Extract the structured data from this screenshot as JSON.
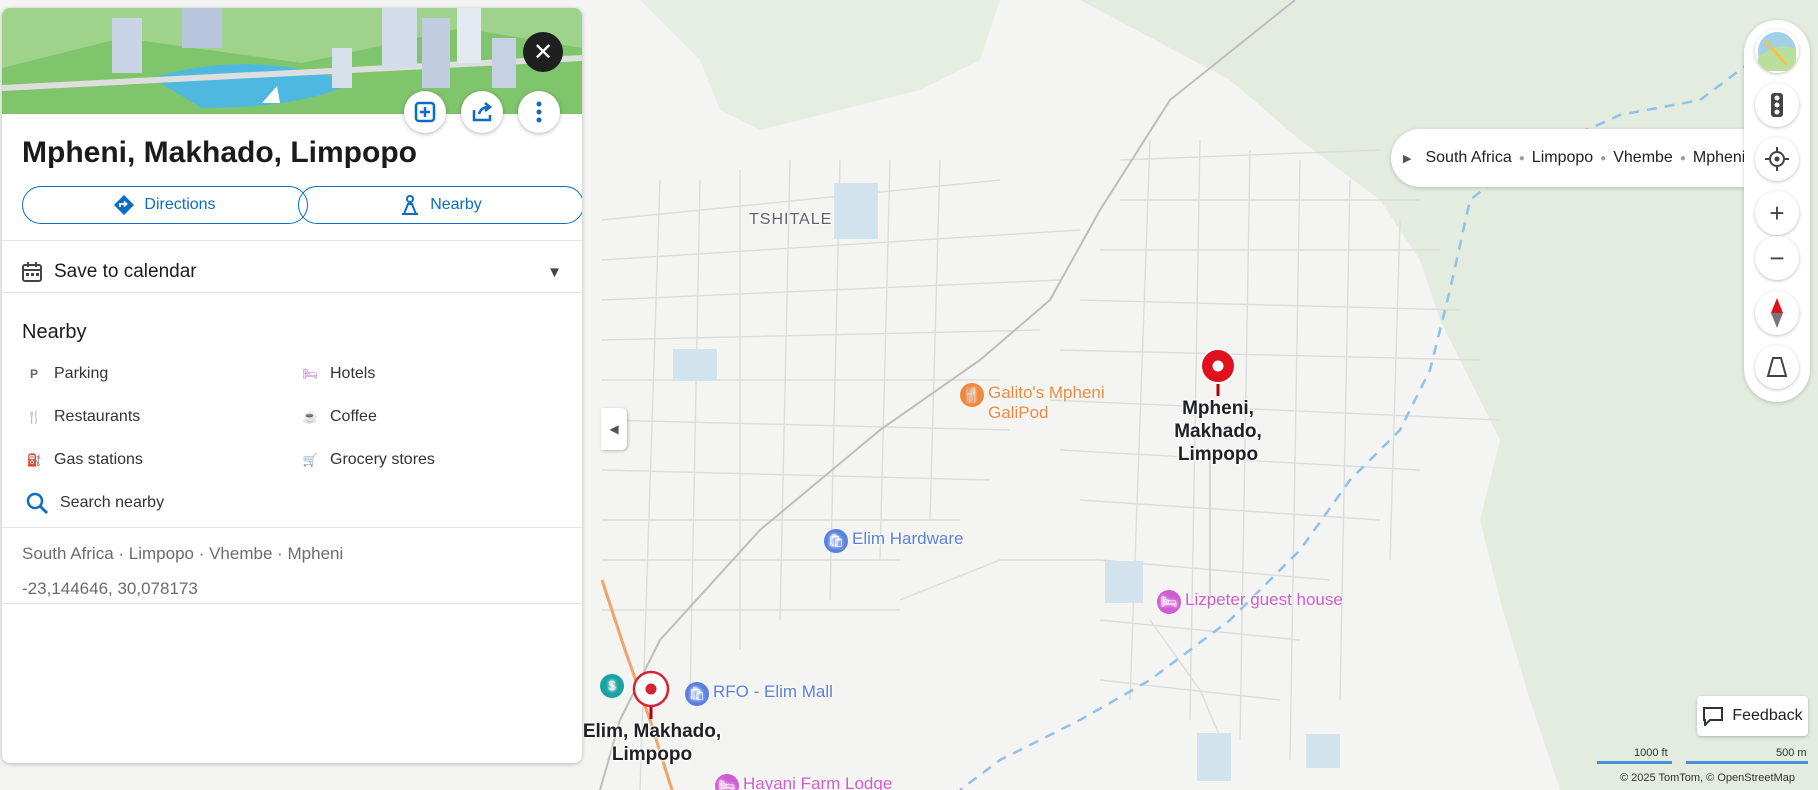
{
  "panel": {
    "title": "Mpheni, Makhado, Limpopo",
    "directions_label": "Directions",
    "nearby_label": "Nearby",
    "calendar_label": "Save to calendar",
    "nearby_heading": "Nearby",
    "nearby_items": [
      "Parking",
      "Hotels",
      "Restaurants",
      "Coffee",
      "Gas stations",
      "Grocery stores"
    ],
    "search_nearby_label": "Search nearby",
    "address": "South Africa · Limpopo · Vhembe · Mpheni",
    "coordinates": "-23,144646, 30,078173",
    "icons": [
      "close-icon",
      "save-icon",
      "share-icon",
      "more-icon",
      "directions-icon",
      "nearby-icon",
      "calendar-icon",
      "chevron-down-icon",
      "search-icon"
    ]
  },
  "breadcrumbs": [
    "South Africa",
    "Limpopo",
    "Vhembe",
    "Mpheni"
  ],
  "map": {
    "area_label": "TSHITALE",
    "pin_main_label": "Mpheni, Makhado, Limpopo",
    "pin_secondary_label": "Elim, Makhado, Limpopo",
    "pois": [
      {
        "name": "Galito's Mpheni GaliPod",
        "color": "#f0883e"
      },
      {
        "name": "Elim Hardware",
        "color": "#5b7fe0"
      },
      {
        "name": "Lizpeter guest house",
        "color": "#d05ccf"
      },
      {
        "name": "RFO - Elim Mall",
        "color": "#5b7fe0"
      },
      {
        "name": "Hayani Farm Lodge",
        "color": "#d05ccf"
      }
    ],
    "pin_color": "#e0101e"
  },
  "controls": [
    "map-style-icon",
    "traffic-icon",
    "locate-icon",
    "zoom-in-icon",
    "zoom-out-icon",
    "compass-icon",
    "tilt-icon"
  ],
  "feedback_label": "Feedback",
  "scale": {
    "imperial": "1000 ft",
    "metric": "500 m"
  },
  "attribution": "© 2025 TomTom,  © OpenStreetMap",
  "accent_color": "#0b6cc4"
}
